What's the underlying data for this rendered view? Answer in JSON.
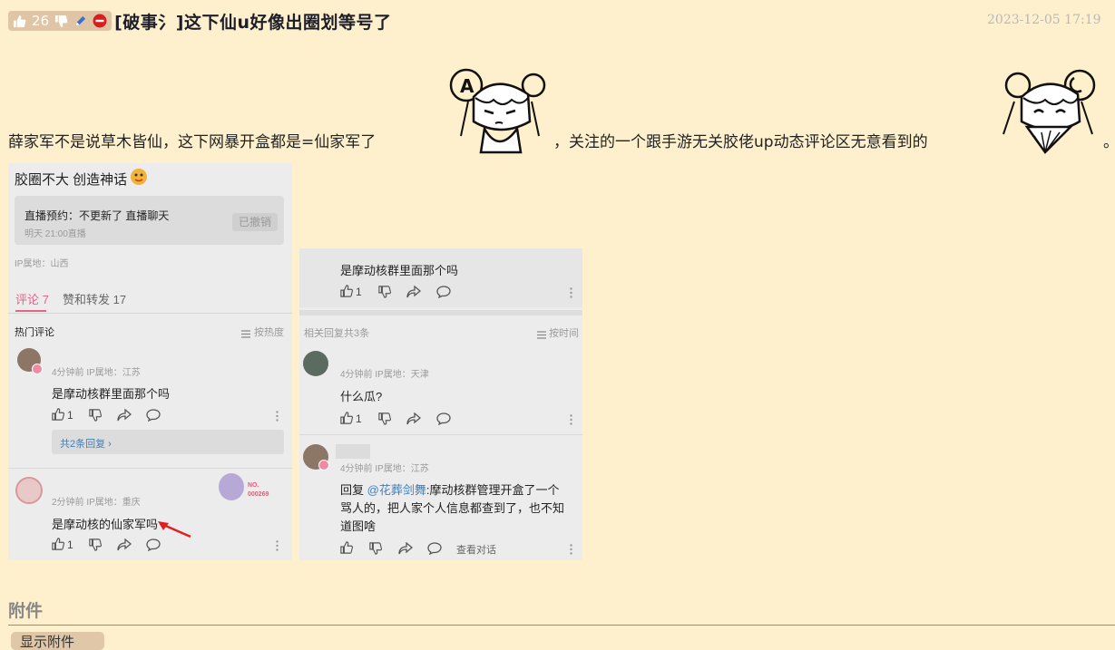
{
  "post": {
    "like_count": "26",
    "title": "[破事氵]这下仙u好像出圈划等号了",
    "date": "2023-12-05 17:19",
    "text_part1": "薛家军不是说草木皆仙，这下网暴开盒都是=仙家军了",
    "text_part2": "，关注的一个跟手游无关胶佬up动态评论区无意看到的",
    "text_part3": "。"
  },
  "shot_left": {
    "heading": "胶圈不大 创造神话",
    "live_title": "直播预约：不更新了 直播聊天",
    "live_time": "明天 21:00直播",
    "live_button": "已撤销",
    "ip": "IP属地：山西",
    "tab_comments": "评论 7",
    "tab_likes": "赞和转发 17",
    "hot_label": "热门评论",
    "sort_label": "按热度",
    "comment1_meta": "4分钟前 IP属地：江苏",
    "comment1_text": "是摩动核群里面那个吗",
    "comment1_likes": "1",
    "comment1_replies": "共2条回复 ›",
    "comment2_meta": "2分钟前 IP属地：重庆",
    "comment2_text": "是摩动核的仙家军吗",
    "comment2_likes": "1",
    "badge_text": "NO.",
    "badge_num": "000269"
  },
  "shot_right": {
    "top_text": "是摩动核群里面那个吗",
    "top_likes": "1",
    "related_label": "相关回复共3条",
    "sort_label": "按时间",
    "reply1_meta": "4分钟前 IP属地：天津",
    "reply1_text": "什么瓜?",
    "reply1_likes": "1",
    "reply2_meta": "4分钟前 IP属地：江苏",
    "reply2_prefix": "回复",
    "reply2_mention": "@花葬剑舞",
    "reply2_line1": ":摩动核群管理开盒了一个",
    "reply2_line2": "骂人的，把人家个人信息都查到了，也不知",
    "reply2_line3": "道图啥",
    "view_convo": "查看对话"
  },
  "attachments": {
    "section_title": "附件",
    "show_button": "显示附件"
  }
}
